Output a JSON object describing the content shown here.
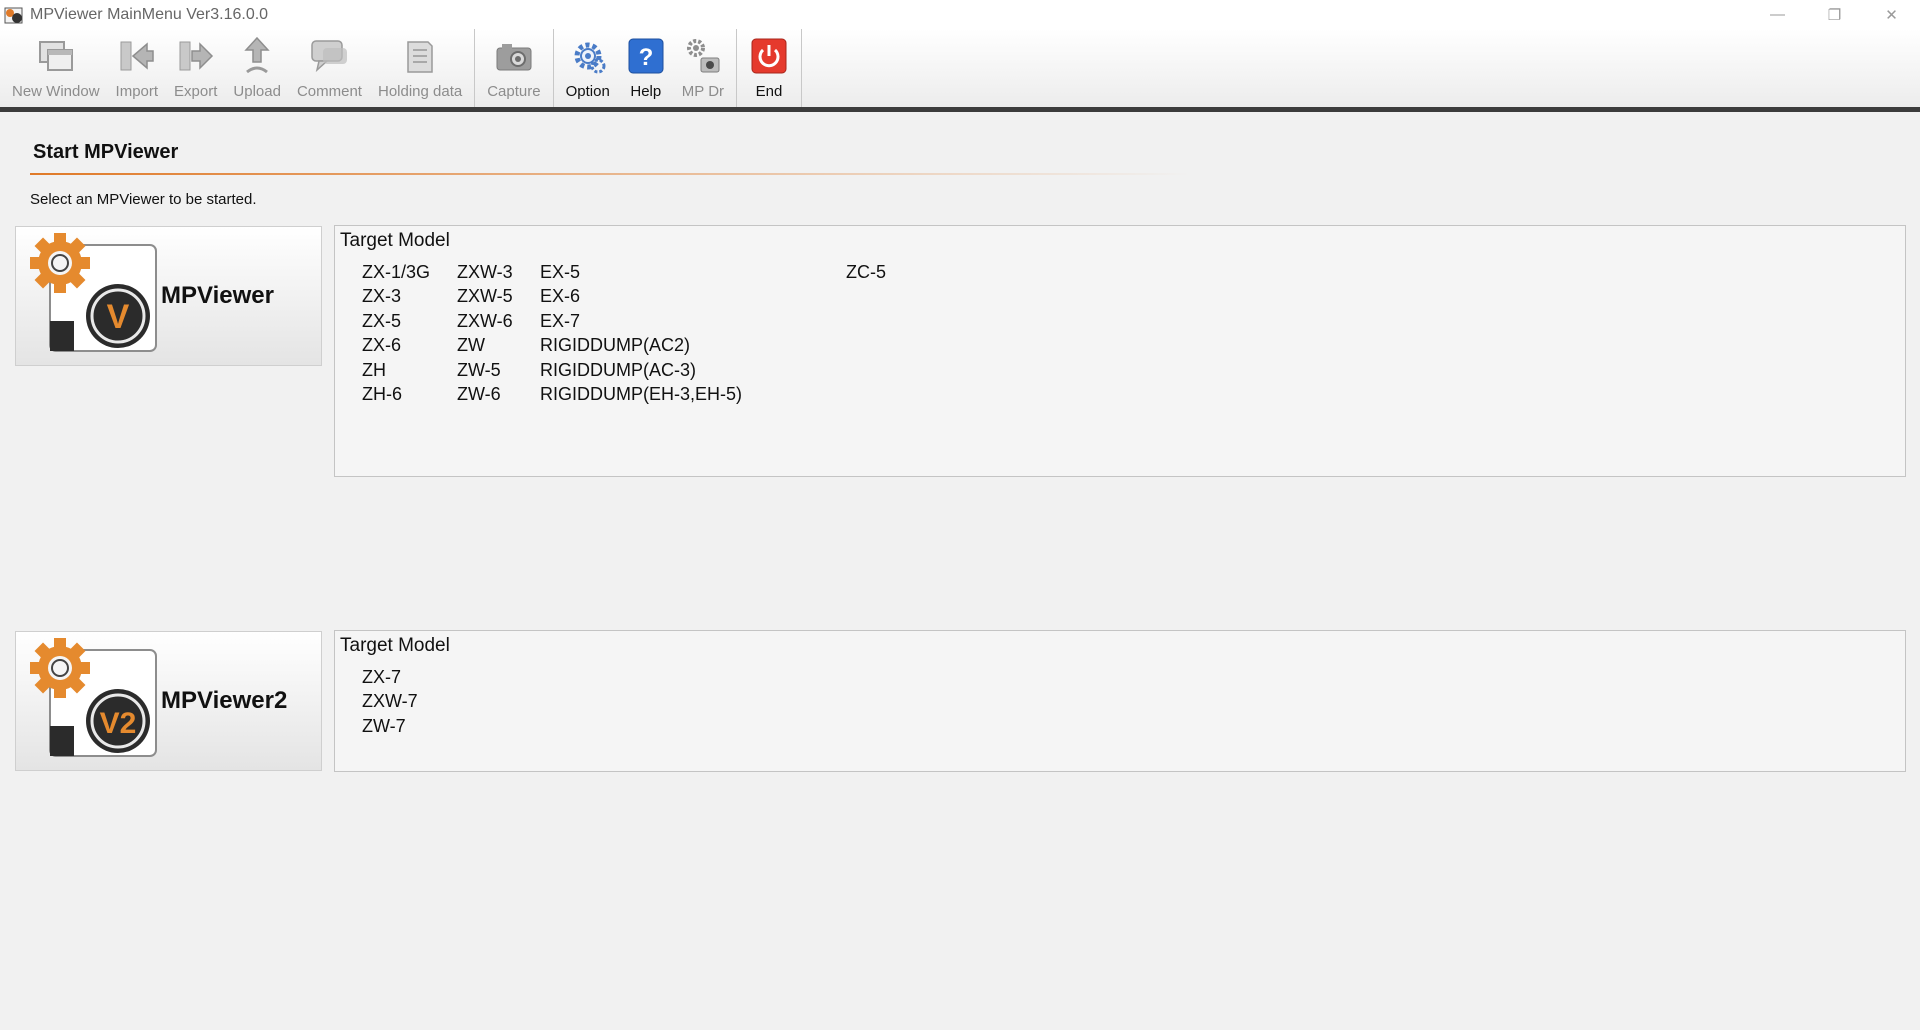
{
  "window": {
    "title": "MPViewer MainMenu Ver3.16.0.0",
    "controls": {
      "minimize": "—",
      "restore": "❐",
      "close": "✕"
    }
  },
  "toolbar": {
    "groups": [
      [
        {
          "id": "new-window",
          "label": "New Window",
          "icon": "new-window-icon",
          "enabled": false
        },
        {
          "id": "import",
          "label": "Import",
          "icon": "import-icon",
          "enabled": false
        },
        {
          "id": "export",
          "label": "Export",
          "icon": "export-icon",
          "enabled": false
        },
        {
          "id": "upload",
          "label": "Upload",
          "icon": "upload-icon",
          "enabled": false
        },
        {
          "id": "comment",
          "label": "Comment",
          "icon": "comment-icon",
          "enabled": false
        },
        {
          "id": "holding-data",
          "label": "Holding data",
          "icon": "holding-data-icon",
          "enabled": false
        }
      ],
      [
        {
          "id": "capture",
          "label": "Capture",
          "icon": "camera-icon",
          "enabled": false
        }
      ],
      [
        {
          "id": "option",
          "label": "Option",
          "icon": "option-gear-icon",
          "enabled": true
        },
        {
          "id": "help",
          "label": "Help",
          "icon": "help-icon",
          "enabled": true
        },
        {
          "id": "mp-dr",
          "label": "MP Dr",
          "icon": "mp-dr-icon",
          "enabled": false
        }
      ],
      [
        {
          "id": "end",
          "label": "End",
          "icon": "power-icon",
          "enabled": true
        }
      ]
    ]
  },
  "main": {
    "heading": "Start MPViewer",
    "instruction": "Select an MPViewer to be started.",
    "accent_color": "#e07a28",
    "viewers": [
      {
        "label": "MPViewer",
        "badge": "V",
        "target_title": "Target Model",
        "model_columns": [
          [
            "ZX-1/3G",
            "ZX-3",
            "ZX-5",
            "ZX-6",
            "ZH",
            "ZH-6"
          ],
          [
            "ZXW-3",
            "ZXW-5",
            "ZXW-6",
            "ZW",
            "ZW-5",
            "ZW-6"
          ],
          [
            "EX-5",
            "EX-6",
            "EX-7",
            "RIGIDDUMP(AC2)",
            "RIGIDDUMP(AC-3)",
            "RIGIDDUMP(EH-3,EH-5)"
          ],
          [
            "ZC-5"
          ]
        ]
      },
      {
        "label": "MPViewer2",
        "badge": "V2",
        "target_title": "Target Model",
        "model_columns": [
          [
            "ZX-7",
            "ZXW-7",
            "ZW-7"
          ]
        ]
      }
    ]
  }
}
